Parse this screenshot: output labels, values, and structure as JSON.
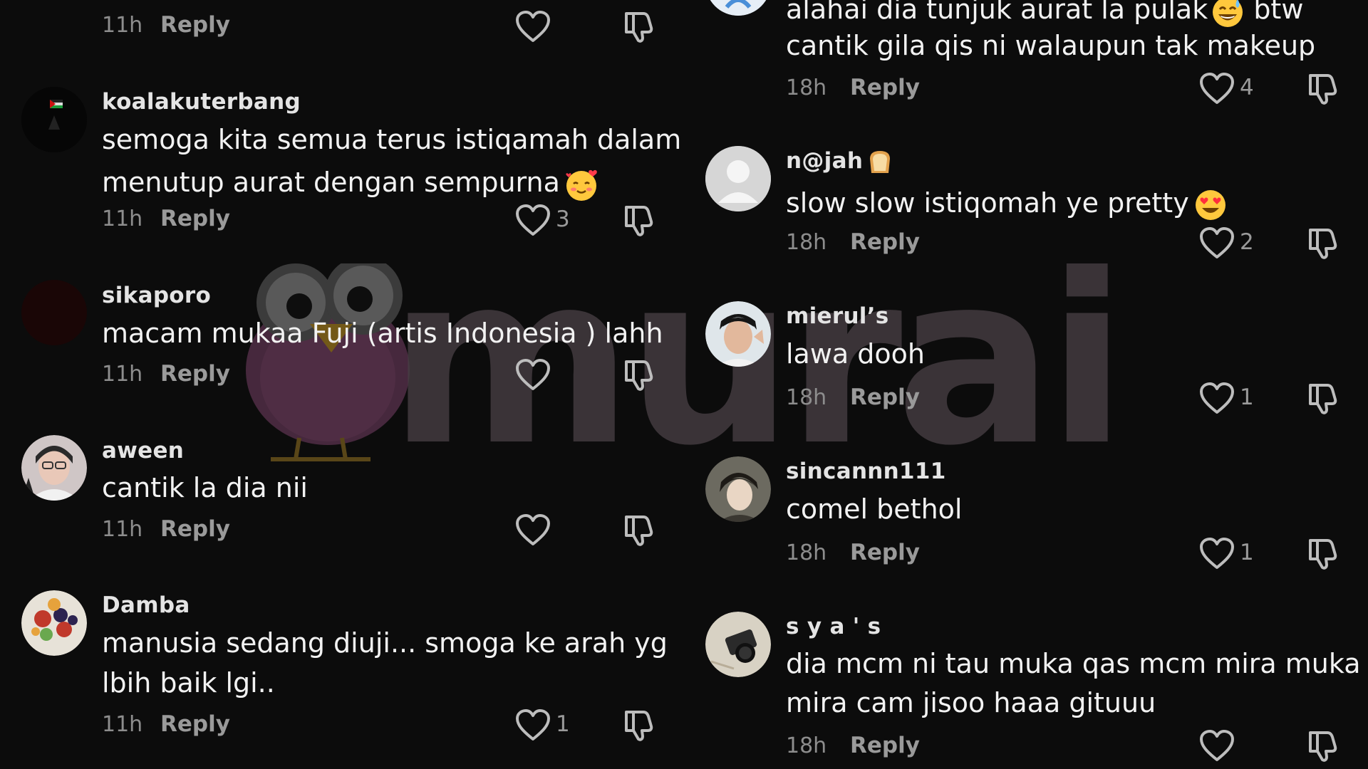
{
  "left_column": [
    {
      "username": "",
      "lines": [],
      "time": "11h",
      "reply": "Reply",
      "likes": ""
    },
    {
      "username": "koalakuterbang",
      "lines": [
        "semoga kita semua terus istiqamah dalam",
        "menutup aurat dengan sempurna"
      ],
      "time": "11h",
      "reply": "Reply",
      "likes": "3"
    },
    {
      "username": "sikaporo",
      "lines": [
        "macam mukaa Fuji (artis Indonesia ) lahh"
      ],
      "time": "11h",
      "reply": "Reply",
      "likes": ""
    },
    {
      "username": "aween",
      "lines": [
        "cantik la dia nii"
      ],
      "time": "11h",
      "reply": "Reply",
      "likes": ""
    },
    {
      "username": "Damba",
      "lines": [
        "manusia sedang diuji... smoga ke arah yg",
        "lbih baik lgi.."
      ],
      "time": "11h",
      "reply": "Reply",
      "likes": "1"
    }
  ],
  "right_column": [
    {
      "username": "",
      "lines": [
        "alahai dia tunjuk aurat la pulak",
        "cantik gila qis ni walaupun tak makeup"
      ],
      "line1_suffix": "btw",
      "time": "18h",
      "reply": "Reply",
      "likes": "4"
    },
    {
      "username": "n@jah",
      "lines": [
        "slow slow istiqomah ye pretty"
      ],
      "time": "18h",
      "reply": "Reply",
      "likes": "2"
    },
    {
      "username": "mierul’s",
      "lines": [
        "lawa dooh"
      ],
      "time": "18h",
      "reply": "Reply",
      "likes": "1"
    },
    {
      "username": "sincannn111",
      "lines": [
        "comel bethol"
      ],
      "time": "18h",
      "reply": "Reply",
      "likes": "1"
    },
    {
      "username": "s y a ' s",
      "lines": [
        "dia mcm ni tau muka qas mcm mira muka",
        "mira cam jisoo haaa gituuu"
      ],
      "time": "18h",
      "reply": "Reply",
      "likes": ""
    }
  ],
  "icons": {
    "like": "heart-outline-icon",
    "dislike": "thumbs-down-outline-icon",
    "emoji_smiling_hearts": "smiling-face-with-hearts-emoji",
    "emoji_grin_sweat": "grinning-sweat-emoji",
    "emoji_heart_eyes": "heart-eyes-emoji",
    "emoji_bread": "bread-emoji"
  },
  "watermark": {
    "text": "murai"
  },
  "colors": {
    "background": "#0c0c0c",
    "text": "#f2f2f2",
    "muted": "#8d8d8d",
    "icon": "#bdbdbd",
    "watermark": "#6b5d66"
  }
}
